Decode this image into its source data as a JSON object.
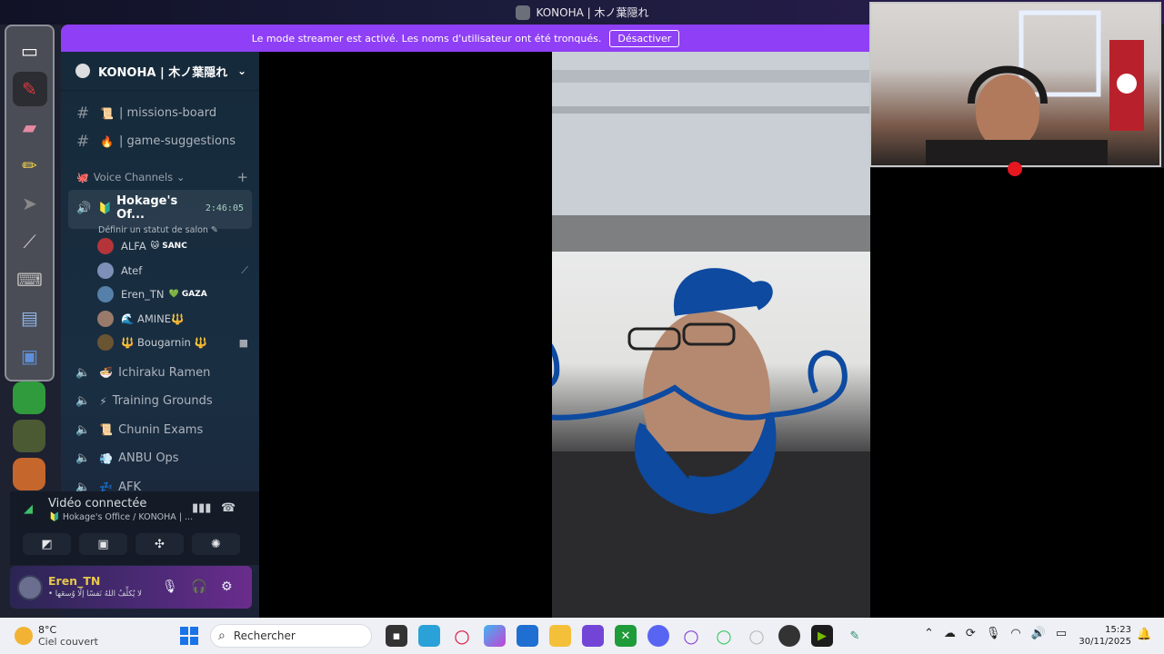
{
  "window": {
    "title": "KONOHA | 木ノ葉隠れ"
  },
  "banner": {
    "text": "Le mode streamer est activé. Les noms d'utilisateur ont été tronqués.",
    "button": "Désactiver"
  },
  "server": {
    "name": "KONOHA | 木ノ葉隠れ"
  },
  "text_channels": [
    {
      "emoji": "📜",
      "name": "| missions-board"
    },
    {
      "emoji": "🔥",
      "name": "| game-suggestions"
    }
  ],
  "voice_category": {
    "label": "Voice Channels ⌄",
    "emoji": "🐙"
  },
  "active_voice": {
    "emoji": "🔰",
    "name": "Hokage's Of...",
    "timer": "2:46:05",
    "status_prompt": "Définir un statut de salon ✎"
  },
  "voice_users": [
    {
      "name": "ALFA",
      "badge": "🐱 SANC",
      "color": "#b4343a",
      "icon": ""
    },
    {
      "name": "Atef",
      "badge": "",
      "color": "#7e8fb8",
      "icon": "🎙̸"
    },
    {
      "name": "Eren_TN",
      "badge": "💚 GAZA",
      "color": "#5580a9",
      "icon": ""
    },
    {
      "name": "🌊 AMINE🔱",
      "badge": "",
      "color": "#9a7a6a",
      "icon": ""
    },
    {
      "name": "🔱 Bougarnin 🔱",
      "badge": "",
      "color": "#6a5532",
      "icon": "📹"
    }
  ],
  "voice_channels": [
    {
      "emoji": "🍜",
      "name": "Ichiraku Ramen"
    },
    {
      "emoji": "⚡",
      "name": "Training Grounds"
    },
    {
      "emoji": "📜",
      "name": "Chunin Exams"
    },
    {
      "emoji": "💨",
      "name": "ANBU Ops"
    },
    {
      "emoji": "💤",
      "name": "AFK"
    }
  ],
  "voice_panel": {
    "title": "Vidéo connectée",
    "subtitle": "🔰 Hokage's Office / KONOHA | ..."
  },
  "user_panel": {
    "name": "Eren_TN",
    "status": "• لا يُكلِّفُ اللهُ نَفسًا إلّا وُسعَها"
  },
  "taskbar": {
    "temperature": "8°C",
    "weather": "Ciel couvert",
    "search_placeholder": "Rechercher",
    "time": "15:23",
    "date": "30/11/2025"
  },
  "colors": {
    "banner": "#8f3ff5",
    "sidebar": "#172c3e",
    "accent_green": "#3fbf68",
    "record": "#e6171f",
    "drawing": "#0d4aa0"
  }
}
